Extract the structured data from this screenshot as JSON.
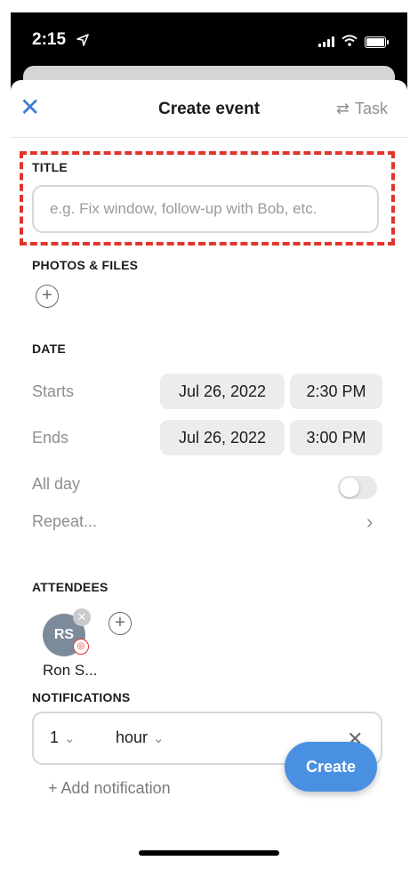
{
  "status_bar": {
    "time": "2:15",
    "navigation_icon": "location-arrow-icon"
  },
  "header": {
    "close_icon": "close-icon",
    "title": "Create event",
    "task_toggle_icon": "swap-arrows-icon",
    "task_toggle_label": "Task"
  },
  "title_section": {
    "label": "TITLE",
    "placeholder": "e.g. Fix window, follow-up with Bob, etc.",
    "value": ""
  },
  "photos_section": {
    "label": "PHOTOS & FILES",
    "add_icon": "plus-circle-icon"
  },
  "date_section": {
    "label": "DATE",
    "starts_label": "Starts",
    "starts_date": "Jul 26, 2022",
    "starts_time": "2:30 PM",
    "ends_label": "Ends",
    "ends_date": "Jul 26, 2022",
    "ends_time": "3:00 PM",
    "all_day_label": "All day",
    "all_day_on": false,
    "repeat_label": "Repeat..."
  },
  "attendees_section": {
    "label": "ATTENDEES",
    "attendees": [
      {
        "initials": "RS",
        "name": "Ron S..."
      }
    ],
    "add_icon": "plus-circle-icon"
  },
  "notifications_section": {
    "label": "NOTIFICATIONS",
    "amount": "1",
    "unit": "hour",
    "add_label": "+ Add notification"
  },
  "create_button_label": "Create",
  "colors": {
    "accent": "#4a90e2",
    "highlight_box": "#e2342b",
    "pill_bg": "#ececee",
    "avatar_bg": "#7c8b99"
  }
}
